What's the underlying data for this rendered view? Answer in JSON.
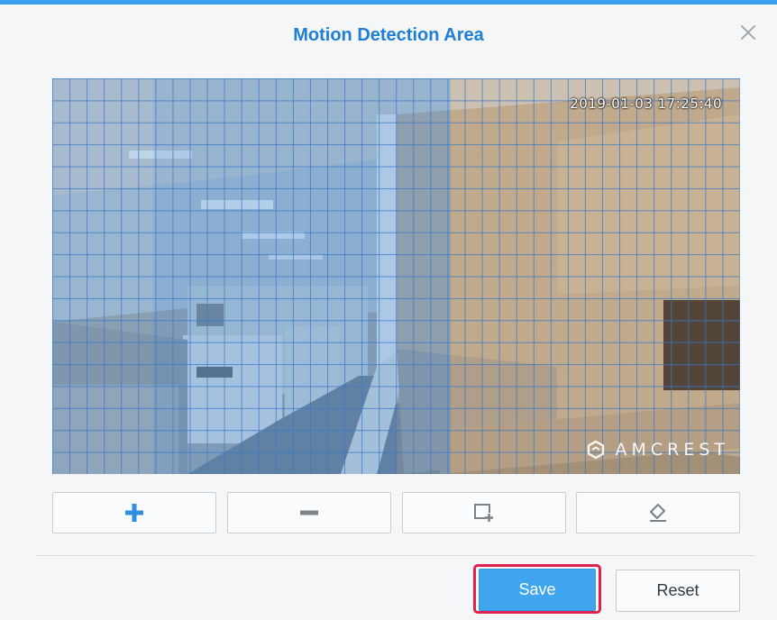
{
  "dialog": {
    "title": "Motion Detection Area",
    "close_icon": "close-icon"
  },
  "camera": {
    "timestamp": "2019-01-03 17:25:40",
    "watermark": "AMCREST",
    "watermark_icon": "amcrest-logo-icon"
  },
  "toolbar": {
    "tools": [
      {
        "icon": "plus-icon",
        "name": "add-area"
      },
      {
        "icon": "minus-icon",
        "name": "remove-area"
      },
      {
        "icon": "select-area-icon",
        "name": "select-area"
      },
      {
        "icon": "eraser-icon",
        "name": "erase"
      }
    ]
  },
  "actions": {
    "save_label": "Save",
    "reset_label": "Reset"
  },
  "colors": {
    "accent": "#3fa5ee",
    "title": "#1e7fd4",
    "highlight": "#e0234e"
  }
}
